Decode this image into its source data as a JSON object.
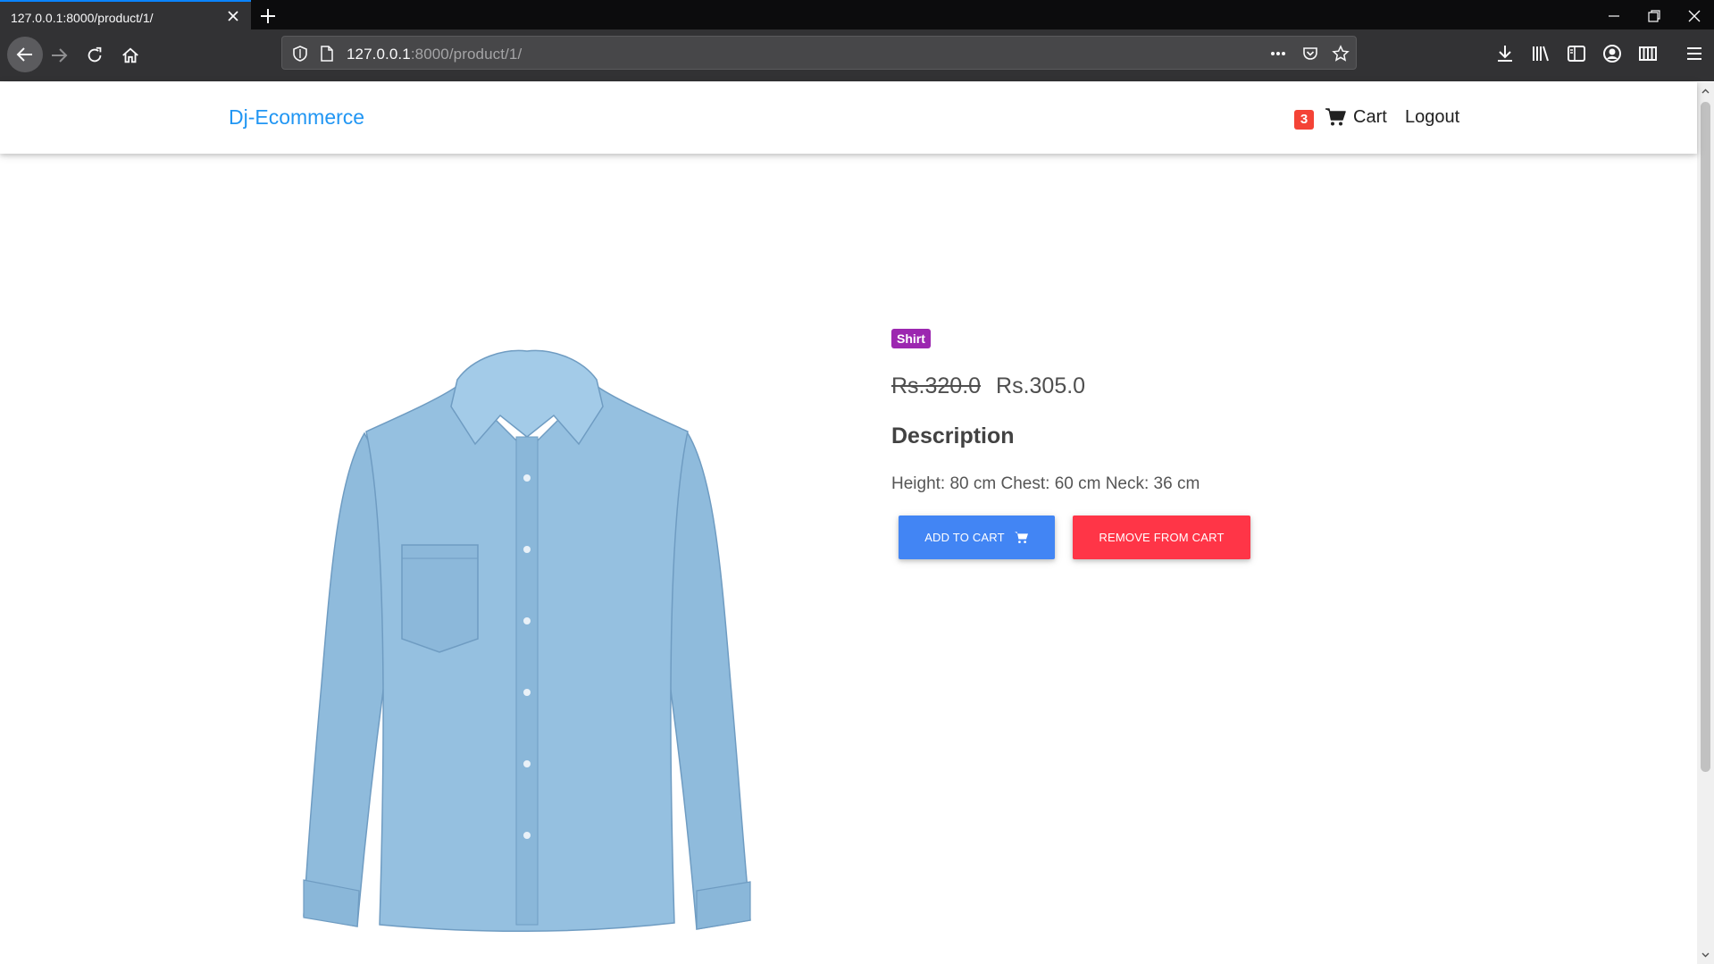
{
  "browser": {
    "tab_title": "127.0.0.1:8000/product/1/",
    "url_host": "127.0.0.1",
    "url_rest": ":8000/product/1/"
  },
  "site": {
    "brand": "Dj-Ecommerce",
    "cart_count": "3",
    "cart_label": "Cart",
    "logout_label": "Logout"
  },
  "product": {
    "category": "Shirt",
    "price_old": "Rs.320.0",
    "price_new": "Rs.305.0",
    "description_heading": "Description",
    "description": "Height: 80 cm Chest: 60 cm Neck: 36 cm",
    "add_to_cart_label": "ADD TO CART",
    "remove_from_cart_label": "REMOVE FROM CART"
  },
  "colors": {
    "brand": "#2196f3",
    "badge_cart": "#f44336",
    "badge_category": "#9c27b0",
    "btn_add": "#4285f4",
    "btn_remove": "#ff3547",
    "shirt": "#8fbbdc"
  },
  "icons": [
    "close-icon",
    "plus-icon",
    "back-arrow-icon",
    "forward-arrow-icon",
    "reload-icon",
    "home-icon",
    "shield-icon",
    "page-icon",
    "more-icon",
    "pocket-icon",
    "star-icon",
    "download-icon",
    "library-icon",
    "sidebar-icon",
    "account-icon",
    "extensions-icon",
    "menu-icon",
    "cart-icon"
  ]
}
